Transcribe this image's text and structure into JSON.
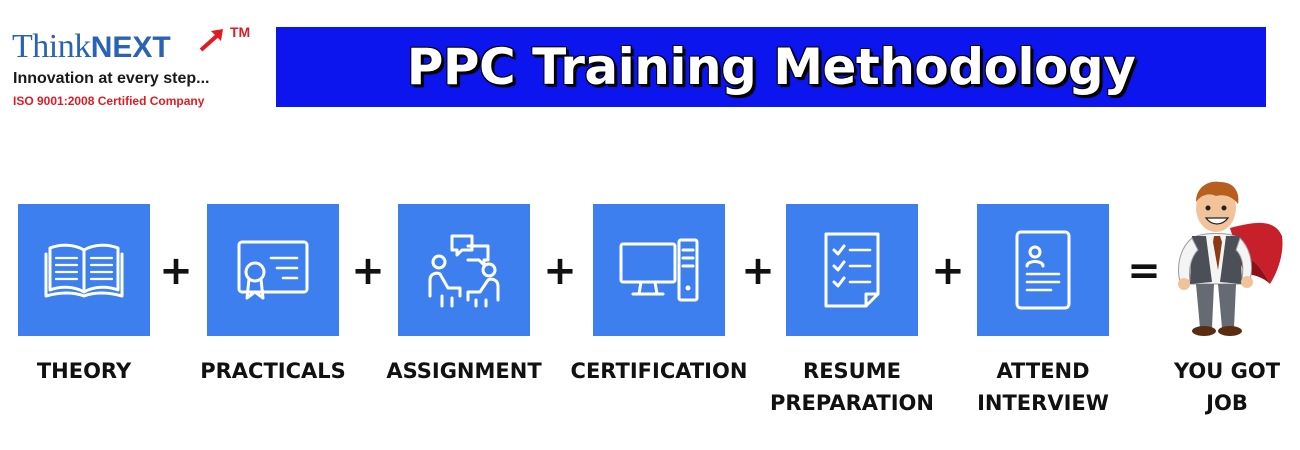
{
  "logo": {
    "think": "Think",
    "next": "NEXT",
    "tm": "TM",
    "tagline": "Innovation at every step...",
    "iso": "ISO 9001:2008 Certified Company"
  },
  "banner": {
    "title": "PPC Training Methodology"
  },
  "steps": [
    {
      "line1": "THEORY",
      "line2": "",
      "icon": "open-book-icon"
    },
    {
      "line1": "PRACTICALS",
      "line2": "",
      "icon": "certificate-icon"
    },
    {
      "line1": "ASSIGNMENT",
      "line2": "",
      "icon": "people-discussion-icon"
    },
    {
      "line1": "CERTIFICATION",
      "line2": "",
      "icon": "computer-icon"
    },
    {
      "line1": "RESUME",
      "line2": "PREPARATION",
      "icon": "checklist-icon"
    },
    {
      "line1": "ATTEND",
      "line2": "INTERVIEW",
      "icon": "resume-profile-icon"
    }
  ],
  "operators": [
    "+",
    "+",
    "+",
    "+",
    "+",
    "="
  ],
  "result": {
    "line1": "YOU GOT",
    "line2": "JOB",
    "icon": "superhero-businessman-icon"
  },
  "colors": {
    "banner": "#0c15ee",
    "box": "#3d7fee",
    "brand_blue": "#2b63b4",
    "brand_red": "#e01b24"
  }
}
